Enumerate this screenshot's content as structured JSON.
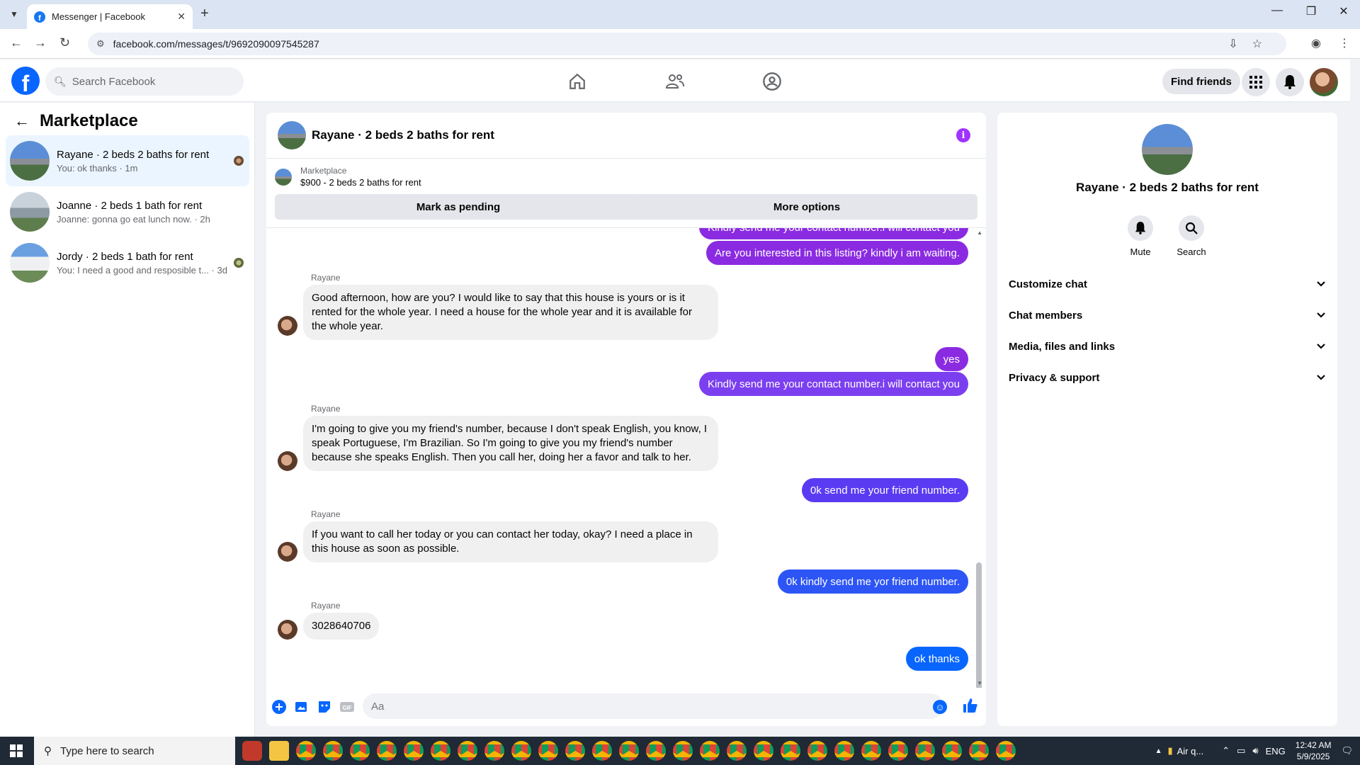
{
  "browser": {
    "tab_title": "Messenger | Facebook",
    "url": "facebook.com/messages/t/9692090097545287"
  },
  "fb": {
    "search_placeholder": "Search Facebook",
    "find_friends": "Find friends"
  },
  "sidebar": {
    "title": "Marketplace",
    "chats": [
      {
        "name": "Rayane · 2 beds 2 baths for rent",
        "preview": "You: ok thanks · 1m"
      },
      {
        "name": "Joanne · 2 beds 1 bath for rent",
        "preview": "Joanne: gonna go eat lunch now. · 2h"
      },
      {
        "name": "Jordy · 2 beds 1 bath for rent",
        "preview": "You: I need a good and resposible t... · 3d"
      }
    ]
  },
  "conversation": {
    "title": "Rayane · 2 beds 2 baths for rent",
    "listing_label": "Marketplace",
    "listing_price": "$900 - 2 beds 2 baths for rent",
    "mark_pending": "Mark as pending",
    "more_options": "More options",
    "messages": {
      "m0": "Kindly send me your contact number.i will contact you",
      "m1": "Are you interested in this listing? kindly i am waiting.",
      "s2": "Rayane",
      "m2": "Good afternoon, how are you? I would like to say that this house is yours or is it rented for the whole year. I need a house for the whole year and it is available for the whole year.",
      "m3": "yes",
      "m4": "Kindly send me your contact number.i will contact you",
      "s5": "Rayane",
      "m5": "I'm going to give you my friend's number, because I don't speak English, you know, I speak Portuguese, I'm Brazilian. So I'm going to give you my friend's number because she speaks English. Then you call her, doing her a favor and talk to her.",
      "m6": "0k send me your friend number.",
      "s7": "Rayane",
      "m7": "If you want to call her today or you can contact her today, okay? I need a place in this house as soon as possible.",
      "m8": "0k kindly send me yor friend number.",
      "s9": "Rayane",
      "m9": "3028640706",
      "m10": "ok thanks"
    },
    "composer_placeholder": "Aa",
    "colors": {
      "bubble_purple": "#8a2be2",
      "bubble_blue": "#0866ff"
    }
  },
  "details": {
    "name": "Rayane · 2 beds 2 baths for rent",
    "mute": "Mute",
    "search": "Search",
    "rows": [
      "Customize chat",
      "Chat members",
      "Media, files and links",
      "Privacy & support"
    ]
  },
  "taskbar": {
    "search_placeholder": "Type here to search",
    "weather": "Air q...",
    "lang": "ENG",
    "time": "12:42 AM",
    "date": "5/9/2025"
  }
}
